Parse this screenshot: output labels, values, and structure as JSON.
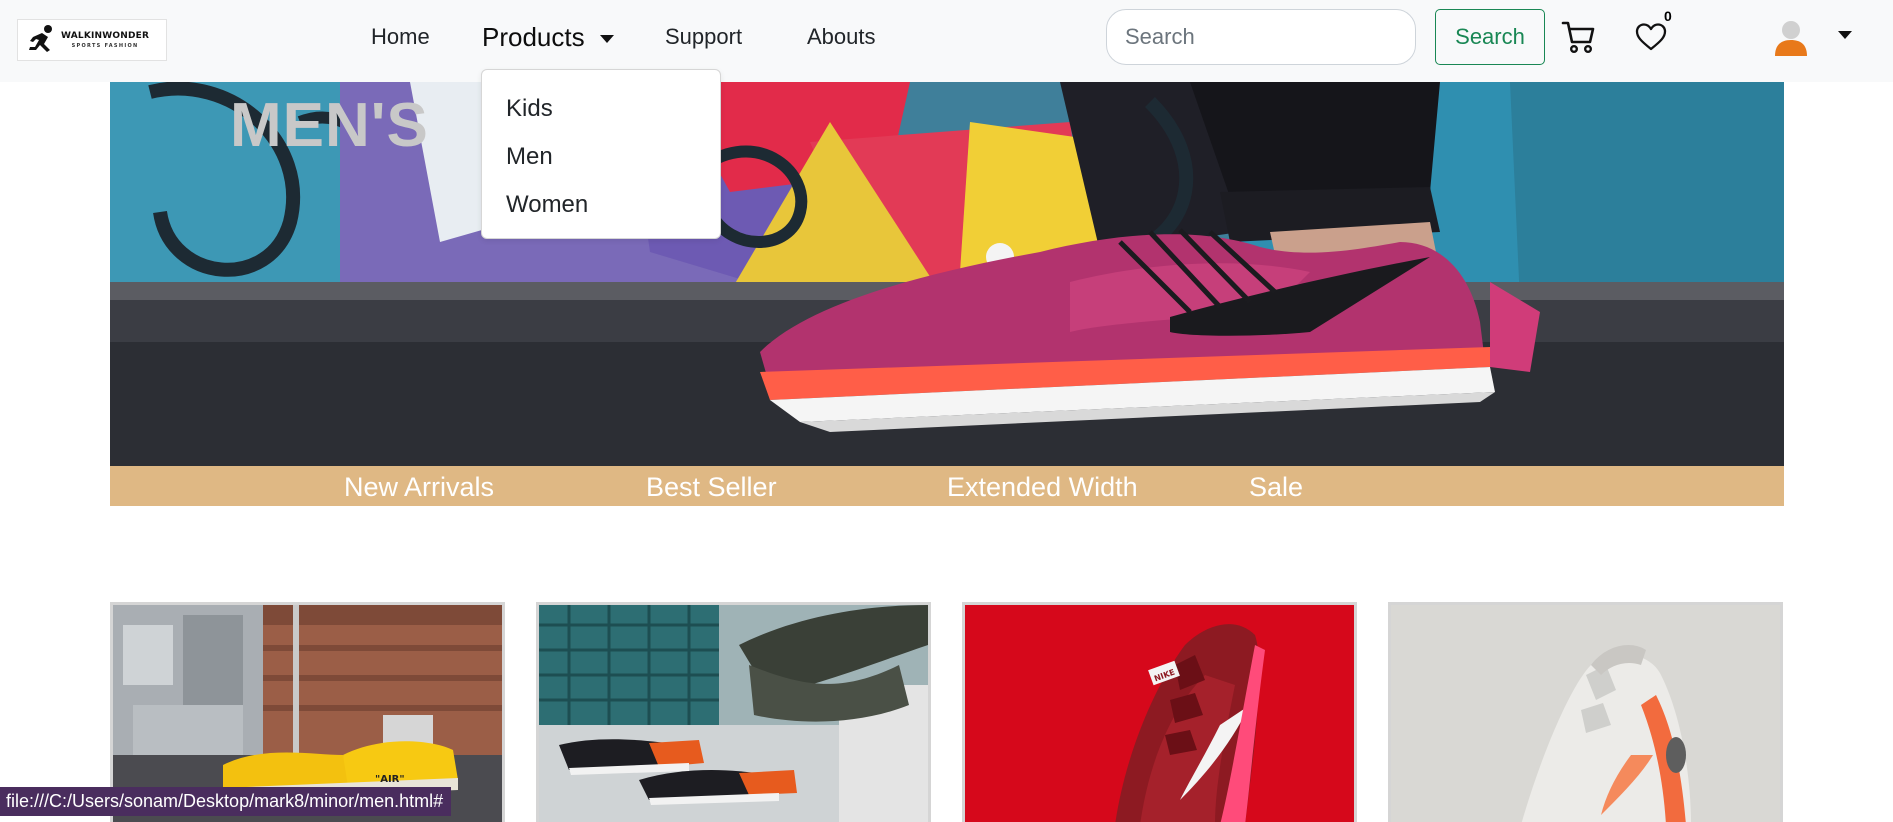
{
  "brand": {
    "name": "WALKINWONDER",
    "tagline": "SPORTS FASHION"
  },
  "nav": {
    "home": "Home",
    "products": "Products",
    "support": "Support",
    "abouts": "Abouts"
  },
  "products_menu": {
    "items": [
      "Kids",
      "Men",
      "Women"
    ]
  },
  "search": {
    "placeholder": "Search",
    "value": "",
    "button_label": "Search"
  },
  "wishlist": {
    "count": "0"
  },
  "icons": {
    "cart": "cart-icon",
    "wishlist": "heart-icon",
    "user": "user-avatar-icon",
    "menu_caret": "chevron-down-icon"
  },
  "hero": {
    "title": "MEN'S"
  },
  "categories": [
    "New Arrivals",
    "Best Seller",
    "Extended Width",
    "Sale"
  ],
  "products": [
    {
      "image": "yellow-air-sneakers-photo"
    },
    {
      "image": "black-orange-sneakers-photo"
    },
    {
      "image": "red-nike-running-shoe-photo"
    },
    {
      "image": "white-orange-sneaker-photo"
    }
  ],
  "status_url": "file:///C:/Users/sonam/Desktop/mark8/minor/men.html#",
  "colors": {
    "navbar_bg": "#f8f9fa",
    "category_bar": "#dfb884",
    "search_button": "#198754",
    "avatar": "#e8791a",
    "status_bar": "#4a2d5e"
  }
}
